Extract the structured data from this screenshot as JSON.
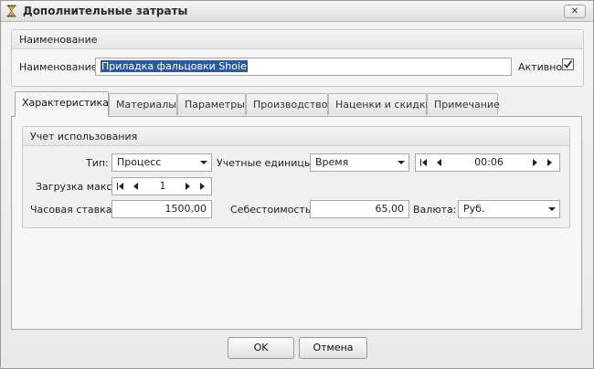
{
  "window": {
    "title": "Дополнительные затраты",
    "close_glyph": "✕"
  },
  "name_group": {
    "header": "Наименование",
    "name_label": "Наименование:",
    "name_value": "Приладка фальцовки Shoie",
    "active_label": "Активно",
    "active_checked": true
  },
  "tabs": [
    {
      "label": "Характеристика",
      "active": true
    },
    {
      "label": "Материалы",
      "active": false
    },
    {
      "label": "Параметры",
      "active": false
    },
    {
      "label": "Производство",
      "active": false
    },
    {
      "label": "Наценки и скидки",
      "active": false
    },
    {
      "label": "Примечание",
      "active": false
    }
  ],
  "usage": {
    "header": "Учет использования",
    "type_label": "Тип:",
    "type_value": "Процесс",
    "units_label": "Учетные единицы:",
    "units_value": "Время",
    "time_value": "00:06",
    "load_label": "Загрузка макс:",
    "load_value": "1",
    "hourly_rate_label": "Часовая ставка:",
    "hourly_rate_value": "1500,00",
    "cost_label": "Себестоимость:",
    "cost_value": "65,00",
    "currency_label": "Валюта:",
    "currency_value": "Руб."
  },
  "buttons": {
    "ok": "OK",
    "cancel": "Отмена"
  }
}
